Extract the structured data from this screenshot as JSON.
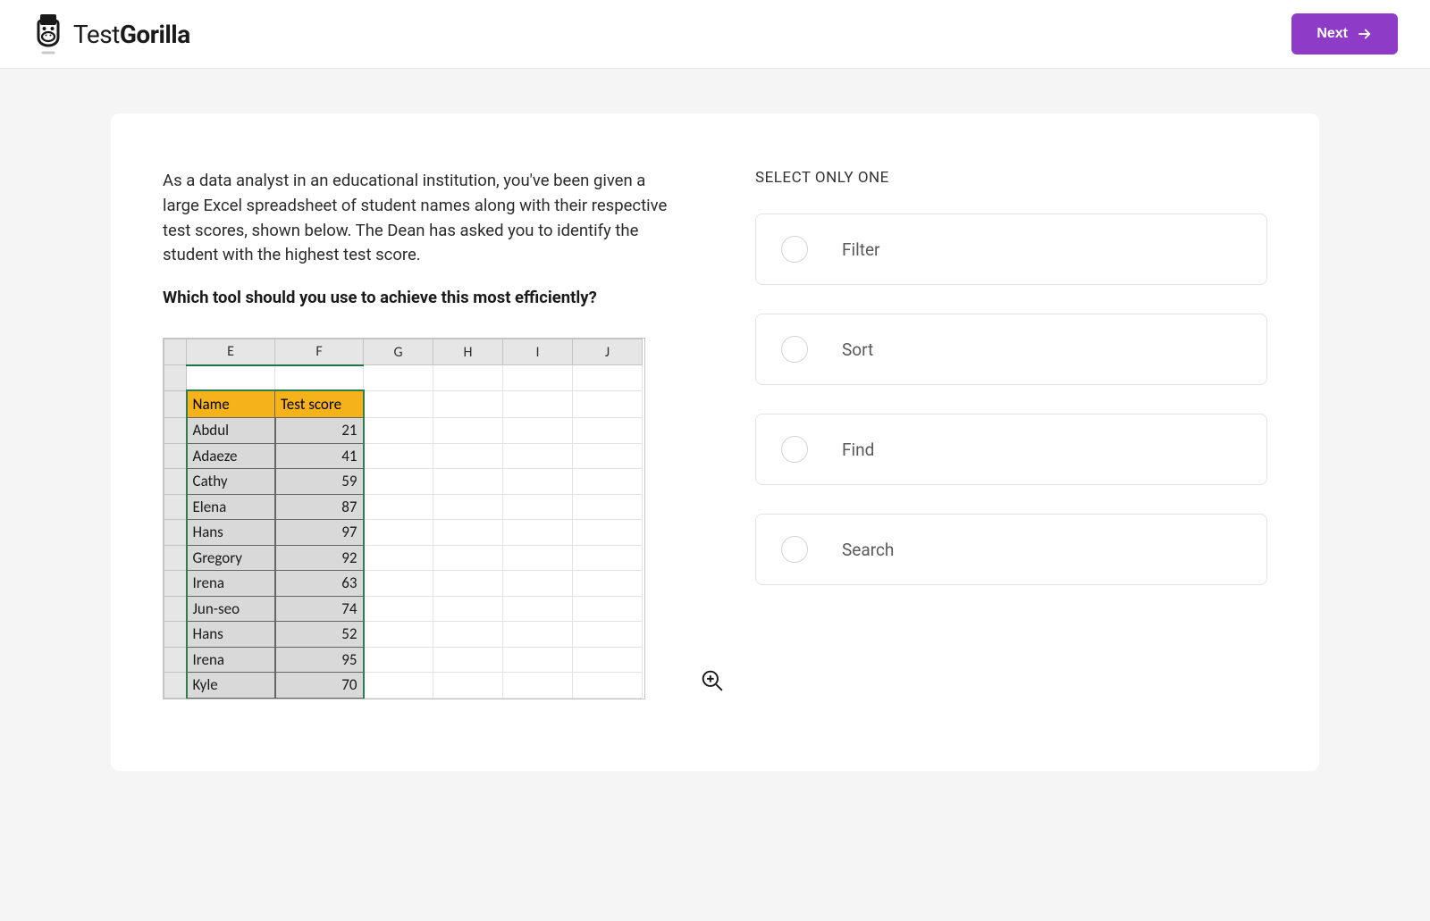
{
  "header": {
    "logo_word1": "Test",
    "logo_word2": "Gorilla",
    "next_label": "Next"
  },
  "question": {
    "body": "As a data analyst in an educational institution, you've been given a large Excel spreadsheet of student names along with their respective test scores, shown below. The Dean has asked you to identify the student with the highest test score.",
    "prompt": "Which tool should you use to achieve this most efficiently?"
  },
  "spreadsheet": {
    "columns": [
      "E",
      "F",
      "G",
      "H",
      "I",
      "J"
    ],
    "headers": {
      "name": "Name",
      "score": "Test score"
    },
    "rows": [
      {
        "name": "Abdul",
        "score": 21
      },
      {
        "name": "Adaeze",
        "score": 41
      },
      {
        "name": "Cathy",
        "score": 59
      },
      {
        "name": "Elena",
        "score": 87
      },
      {
        "name": "Hans",
        "score": 97
      },
      {
        "name": "Gregory",
        "score": 92
      },
      {
        "name": "Irena",
        "score": 63
      },
      {
        "name": "Jun-seo",
        "score": 74
      },
      {
        "name": "Hans",
        "score": 52
      },
      {
        "name": "Irena",
        "score": 95
      },
      {
        "name": "Kyle",
        "score": 70
      }
    ]
  },
  "answers": {
    "instruction": "SELECT ONLY ONE",
    "options": [
      {
        "label": "Filter"
      },
      {
        "label": "Sort"
      },
      {
        "label": "Find"
      },
      {
        "label": "Search"
      }
    ]
  }
}
